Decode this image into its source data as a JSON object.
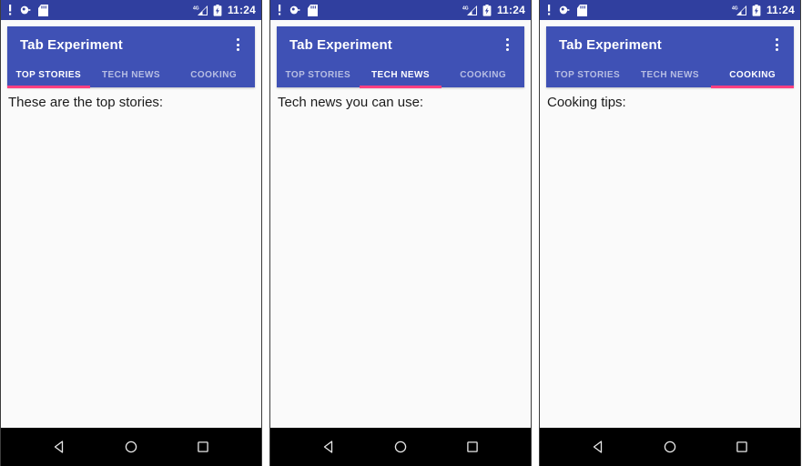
{
  "statusbar": {
    "time": "11:24",
    "left_icons": [
      "alert-exclamation-icon",
      "bug-icon",
      "sd-card-icon"
    ],
    "right_icons": [
      "signal-4g-icon",
      "battery-charging-icon"
    ],
    "network_label": "4G",
    "background_color": "#303F9F"
  },
  "appbar": {
    "title": "Tab Experiment",
    "overflow_label": "More options",
    "background_color": "#3F51B5",
    "indicator_color": "#FF4081"
  },
  "navbar": {
    "back_label": "Back",
    "home_label": "Home",
    "recents_label": "Recent apps"
  },
  "tabs": [
    {
      "label": "TOP STORIES"
    },
    {
      "label": "TECH NEWS"
    },
    {
      "label": "COOKING"
    }
  ],
  "screens": [
    {
      "active_tab_index": 0,
      "body_text": "These are the top stories:"
    },
    {
      "active_tab_index": 1,
      "body_text": "Tech news you can use:"
    },
    {
      "active_tab_index": 2,
      "body_text": "Cooking tips:"
    }
  ]
}
